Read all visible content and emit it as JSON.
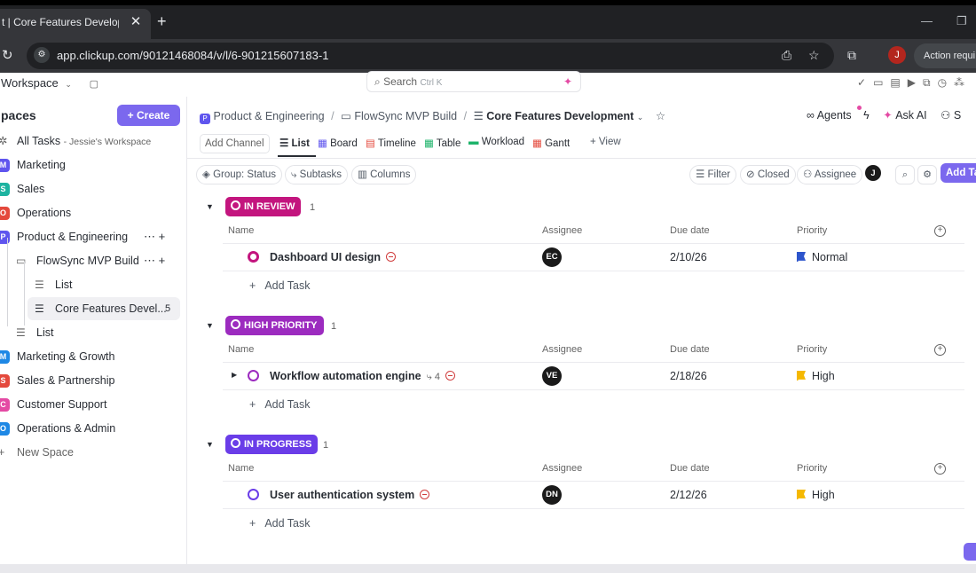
{
  "browser": {
    "tab_title": "t | Core Features Developme",
    "url": "app.clickup.com/90121468084/v/l/6-901215607183-1",
    "profile_initial": "J",
    "action_required": "Action requi"
  },
  "appbar": {
    "workspace": "Workspace",
    "search_placeholder": "Search",
    "search_shortcut": "Ctrl K"
  },
  "sidebar": {
    "title": "paces",
    "create_label": "Create",
    "all_tasks": {
      "label": "All Tasks",
      "sub": "- Jessie's Workspace"
    },
    "spaces": [
      {
        "badge": "M",
        "label": "Marketing",
        "color": "#5f55ee"
      },
      {
        "badge": "S",
        "label": "Sales",
        "color": "#1db3a0"
      },
      {
        "badge": "O",
        "label": "Operations",
        "color": "#e4493c"
      },
      {
        "badge": "P",
        "label": "Product & Engineering",
        "color": "#5f55ee"
      }
    ],
    "folder": "FlowSync MVP Build",
    "folder_lists": [
      {
        "label": "List"
      },
      {
        "label": "Core Features Devel...",
        "count": "5"
      }
    ],
    "pe_list": "List",
    "more_spaces": [
      {
        "badge": "M",
        "label": "Marketing & Growth",
        "color": "#1e88e5"
      },
      {
        "badge": "S",
        "label": "Sales & Partnership",
        "color": "#e4493c"
      },
      {
        "badge": "C",
        "label": "Customer Support",
        "color": "#e44aa4"
      },
      {
        "badge": "O",
        "label": "Operations & Admin",
        "color": "#1e88e5"
      }
    ],
    "new_space": "New Space"
  },
  "breadcrumb": {
    "space": "Product & Engineering",
    "folder": "FlowSync MVP Build",
    "list": "Core Features Development"
  },
  "header_actions": {
    "agents": "Agents",
    "ask_ai": "Ask AI",
    "share": "S"
  },
  "views": {
    "add_channel": "Add Channel",
    "tabs": [
      "List",
      "Board",
      "Timeline",
      "Table",
      "Workload",
      "Gantt"
    ],
    "add_view": "View"
  },
  "toolbar": {
    "group": "Group: Status",
    "subtasks": "Subtasks",
    "columns": "Columns",
    "filter": "Filter",
    "closed": "Closed",
    "assignee": "Assignee",
    "me_initial": "J",
    "add_task": "Add Ta"
  },
  "columns": {
    "name": "Name",
    "assignee": "Assignee",
    "due": "Due date",
    "priority": "Priority"
  },
  "add_task_label": "Add Task",
  "groups": [
    {
      "status": "IN REVIEW",
      "count": "1",
      "color": "#c3157e",
      "tasks": [
        {
          "name": "Dashboard UI design",
          "assignee": "EC",
          "due": "2/10/26",
          "priority": "Normal",
          "priority_color": "#2d55cc",
          "subtasks": ""
        }
      ]
    },
    {
      "status": "HIGH PRIORITY",
      "count": "1",
      "color": "#9c2bbf",
      "tasks": [
        {
          "name": "Workflow automation engine",
          "assignee": "VE",
          "due": "2/18/26",
          "priority": "High",
          "priority_color": "#f5b800",
          "subtasks": "4"
        }
      ]
    },
    {
      "status": "IN PROGRESS",
      "count": "1",
      "color": "#6a3de8",
      "tasks": [
        {
          "name": "User authentication system",
          "assignee": "DN",
          "due": "2/12/26",
          "priority": "High",
          "priority_color": "#f5b800",
          "subtasks": ""
        }
      ]
    }
  ]
}
